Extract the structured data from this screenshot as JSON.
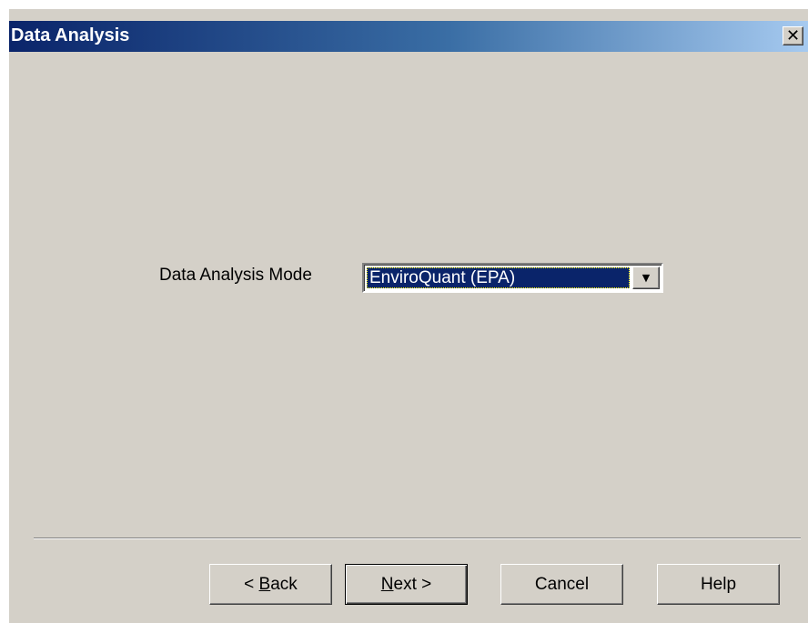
{
  "window": {
    "title": "Data Analysis",
    "close_glyph": "✕",
    "close_icon": "close-icon"
  },
  "form": {
    "mode_label": "Data Analysis Mode",
    "mode_value": "EnviroQuant (EPA)",
    "dropdown_icon": "chevron-down-icon"
  },
  "buttons": {
    "back": {
      "prefix": "< ",
      "accel": "B",
      "rest": "ack"
    },
    "next": {
      "accel": "N",
      "rest": "ext >"
    },
    "cancel": "Cancel",
    "help": "Help"
  },
  "colors": {
    "titlebar_start": "#0a246a",
    "titlebar_end": "#a6caf0",
    "dialog_bg": "#d4d0c8",
    "selection": "#0a246a"
  }
}
